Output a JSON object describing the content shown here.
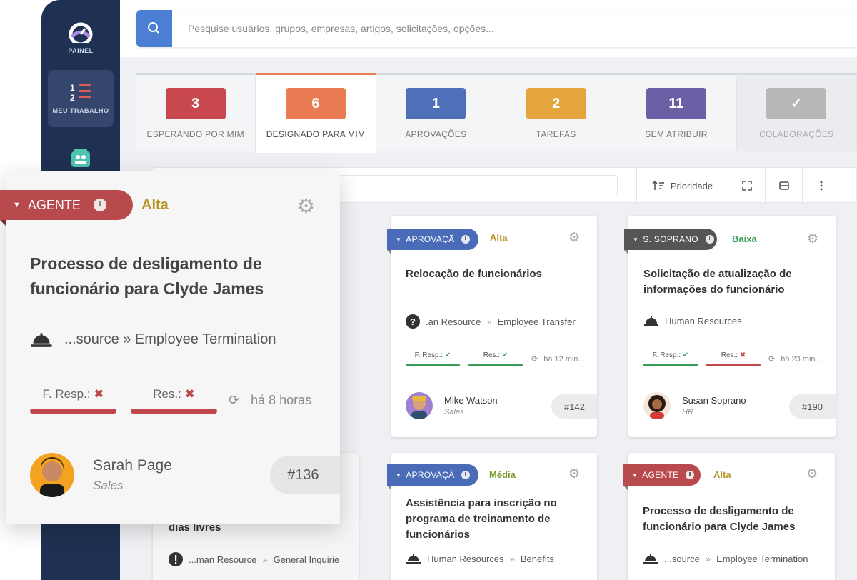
{
  "sidebar": {
    "items": [
      {
        "label": "PAINEL",
        "icon": "dashboard-gauge-icon"
      },
      {
        "label": "MEU TRABALHO",
        "icon": "numbered-list-icon"
      },
      {
        "label": "",
        "icon": "people-group-icon"
      }
    ]
  },
  "search": {
    "placeholder": "Pesquise usuários, grupos, empresas, artigos, solicitações, opções..."
  },
  "tabs": [
    {
      "count": "3",
      "label": "ESPERANDO POR MIM",
      "color": "#c9484d"
    },
    {
      "count": "6",
      "label": "DESIGNADO PARA MIM",
      "color": "#e97c52"
    },
    {
      "count": "1",
      "label": "APROVAÇÕES",
      "color": "#4f6fb8"
    },
    {
      "count": "2",
      "label": "TAREFAS",
      "color": "#e4a53e"
    },
    {
      "count": "11",
      "label": "SEM ATRIBUIR",
      "color": "#6d5fa6"
    },
    {
      "count": "✓",
      "label": "COLABORAÇÕES",
      "color": "#b8b8b8"
    }
  ],
  "toolbar": {
    "sort_label": "Prioridade"
  },
  "cards": [
    {
      "ribbon": "APROVAÇÃ",
      "ribbon_color": "#4a6bb8",
      "priority": "Alta",
      "priority_color": "#b8962a",
      "title": "Relocação de funcionários",
      "path_prefix": ".an Resource",
      "path_sep": "»",
      "path_suffix": "Employee Transfer",
      "path_icon": "question-circle-icon",
      "resp_label": "F. Resp.:",
      "resp_status": "ok",
      "res_label": "Res.:",
      "res_status": "ok",
      "time": "há 12 min...",
      "person_name": "Mike Watson",
      "person_dept": "Sales",
      "id": "#142"
    },
    {
      "ribbon": "S. SOPRANO",
      "ribbon_color": "#555555",
      "priority": "Baixa",
      "priority_color": "#3a9e5a",
      "title": "Solicitação de atualização de informações do funcionário",
      "path_prefix": "Human Resources",
      "path_sep": "",
      "path_suffix": "",
      "path_icon": "service-bell-icon",
      "resp_label": "F. Resp.:",
      "resp_status": "ok",
      "res_label": "Res.:",
      "res_status": "bad",
      "time": "há 23 min...",
      "person_name": "Susan Soprano",
      "person_dept": "HR",
      "id": "#190"
    },
    {
      "ribbon": "APROVAÇÃ",
      "ribbon_color": "#4a6bb8",
      "priority": "Média",
      "priority_color": "#7a9a2a",
      "title": "Assistência para inscrição no programa de treinamento de funcionários",
      "path_prefix": "Human Resources",
      "path_sep": "»",
      "path_suffix": "Benefits",
      "path_icon": "service-bell-icon"
    },
    {
      "ribbon": "AGENTE",
      "ribbon_color": "#b8494d",
      "priority": "Alta",
      "priority_color": "#b8962a",
      "title": "Processo de desligamento de funcionário para Clyde James",
      "path_prefix": "...source",
      "path_sep": "»",
      "path_suffix": "Employee Termination",
      "path_icon": "service-bell-icon"
    },
    {
      "title": "dias livres",
      "path_prefix": "...man Resource",
      "path_sep": "»",
      "path_suffix": "General Inquirie",
      "path_icon": "exclamation-circle-icon"
    }
  ],
  "bigcard": {
    "ribbon": "AGENTE",
    "ribbon_color": "#b8494d",
    "priority": "Alta",
    "priority_color": "#b8962a",
    "title": "Processo de desligamento de funcionário para Clyde James",
    "path": "...source » Employee Termination",
    "resp_label": "F. Resp.:",
    "res_label": "Res.:",
    "time": "há 8 horas",
    "person_name": "Sarah Page",
    "person_dept": "Sales",
    "id": "#136"
  }
}
